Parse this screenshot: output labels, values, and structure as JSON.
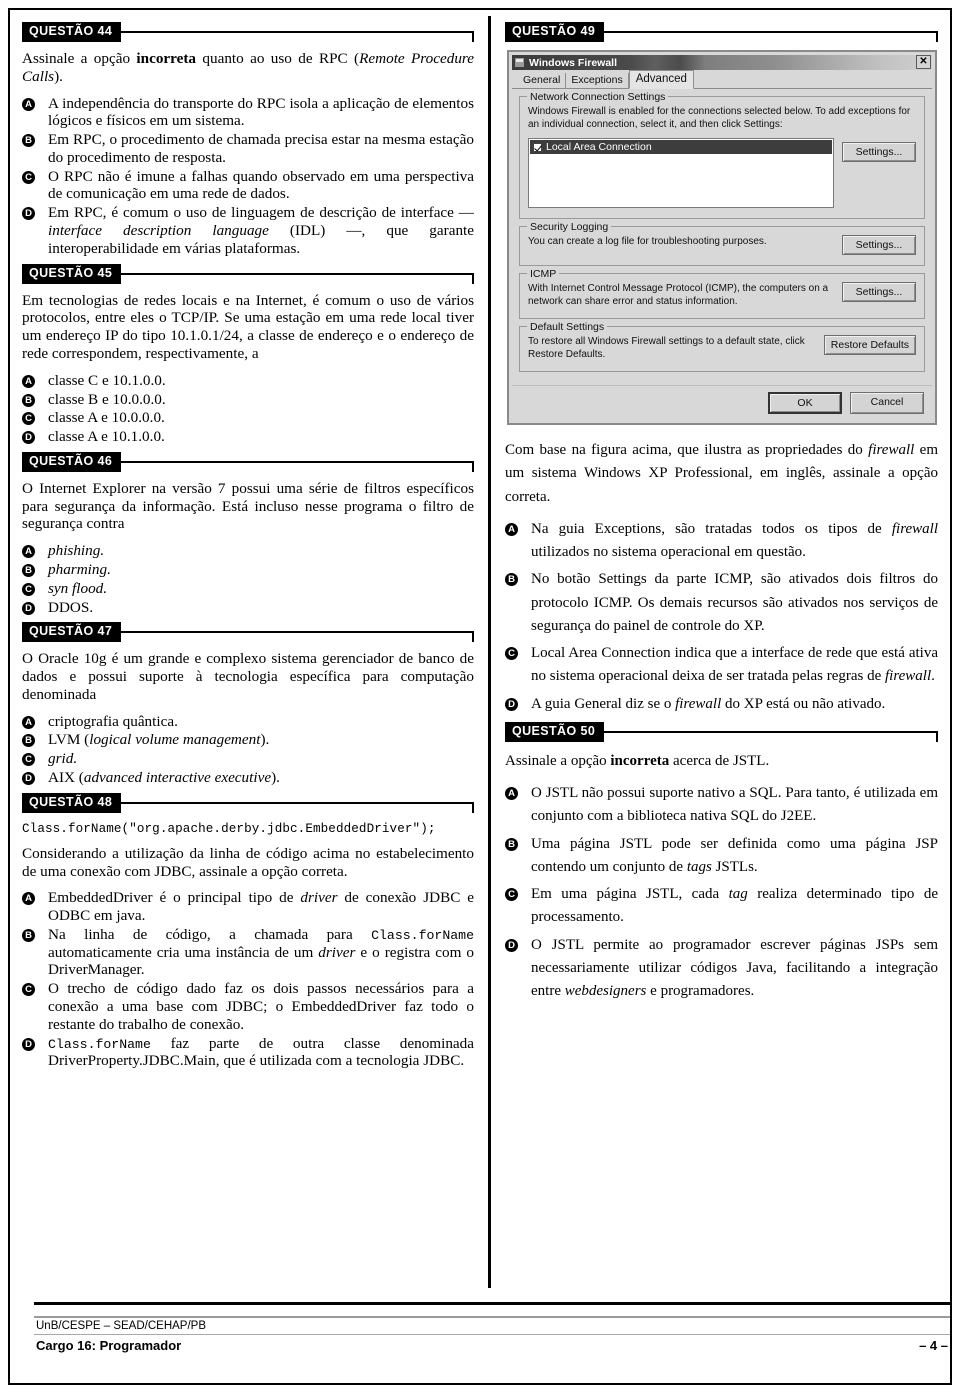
{
  "document": {
    "footer": {
      "institution": "UnB/CESPE – SEAD/CEHAP/PB",
      "role": "Cargo 16: Programador",
      "page_number": "– 4 –"
    }
  },
  "questions": {
    "q44": {
      "label": "QUESTÃO 44",
      "stem_a": "Assinale a opção ",
      "stem_bold": "incorreta",
      "stem_b": " quanto ao uso de RPC (",
      "stem_italic": "Remote Procedure Calls",
      "stem_c": ").",
      "options": [
        {
          "letter": "A",
          "text": "A independência do transporte do RPC isola a aplicação de elementos lógicos e físicos em um sistema."
        },
        {
          "letter": "B",
          "text": "Em RPC, o procedimento de chamada precisa estar na mesma estação do procedimento de resposta."
        },
        {
          "letter": "C",
          "text": "O RPC não é imune a falhas quando observado em uma perspectiva de comunicação em uma rede de dados."
        },
        {
          "letter": "D",
          "text": ""
        }
      ],
      "option_d_pre": "Em RPC, é comum o uso de linguagem de descrição de interface — ",
      "option_d_italic": "interface description language",
      "option_d_post": " (IDL) —, que garante interoperabilidade em várias plataformas."
    },
    "q45": {
      "label": "QUESTÃO 45",
      "stem": "Em tecnologias de redes locais e na Internet, é comum o uso de vários protocolos, entre eles o TCP/IP. Se uma estação em uma rede local tiver um endereço IP do tipo 10.1.0.1/24, a classe de endereço e o endereço de rede correspondem, respectivamente, a",
      "options": [
        {
          "letter": "A",
          "text": "classe C e 10.1.0.0."
        },
        {
          "letter": "B",
          "text": "classe B e 10.0.0.0."
        },
        {
          "letter": "C",
          "text": "classe A e 10.0.0.0."
        },
        {
          "letter": "D",
          "text": "classe A e 10.1.0.0."
        }
      ]
    },
    "q46": {
      "label": "QUESTÃO 46",
      "stem": "O Internet Explorer na versão 7 possui uma série de filtros específicos para segurança da informação. Está incluso nesse programa o filtro de segurança contra",
      "options": [
        {
          "letter": "A",
          "text": "phishing.",
          "italic": true
        },
        {
          "letter": "B",
          "text": "pharming.",
          "italic": true
        },
        {
          "letter": "C",
          "text": "syn flood.",
          "italic": true
        },
        {
          "letter": "D",
          "text": "DDOS.",
          "italic": false
        }
      ]
    },
    "q47": {
      "label": "QUESTÃO 47",
      "stem": "O Oracle 10g é um grande e complexo sistema gerenciador de banco de dados e possui suporte à tecnologia específica para computação denominada",
      "options": [
        {
          "letter": "A",
          "text": "criptografia quântica."
        },
        {
          "letter": "B",
          "text": "LVM (logical volume management)."
        },
        {
          "letter": "C",
          "text": "grid."
        },
        {
          "letter": "D",
          "text": "AIX (advanced interactive executive)."
        }
      ],
      "option_b_pre": "LVM (",
      "option_b_italic": "logical volume management",
      "option_b_post": ").",
      "option_c_italic": "grid.",
      "option_d_pre": "AIX (",
      "option_d_italic": "advanced interactive executive",
      "option_d_post": ")."
    },
    "q48": {
      "label": "QUESTÃO 48",
      "code": "Class.forName(\"org.apache.derby.jdbc.EmbeddedDriver\");",
      "stem": "Considerando a utilização da linha de código acima no estabelecimento de uma conexão com JDBC, assinale a opção correta.",
      "option_a_pre": "EmbeddedDriver é o principal tipo de ",
      "option_a_italic": "driver",
      "option_a_post": " de conexão JDBC e ODBC em java.",
      "option_b_pre": "Na linha de código, a chamada para ",
      "option_b_mono": "Class.forName",
      "option_b_mid": " automaticamente cria uma instância de um ",
      "option_b_italic": "driver",
      "option_b_post": " e o registra com o DriverManager.",
      "option_c": "O trecho de código dado faz os dois passos necessários para a conexão a uma base com JDBC; o EmbeddedDriver faz todo o restante do trabalho de conexão.",
      "option_d_mono": "Class.forName",
      "option_d_post": " faz parte de outra classe denominada DriverProperty.JDBC.Main, que é utilizada com a tecnologia JDBC.",
      "letters": [
        "A",
        "B",
        "C",
        "D"
      ]
    },
    "q49": {
      "label": "QUESTÃO 49",
      "stem_pre": "Com base na figura acima, que ilustra as propriedades do ",
      "stem_italic": "firewall",
      "stem_post": " em um sistema Windows XP Professional, em inglês, assinale a opção correta.",
      "option_a_pre": "Na guia Exceptions, são tratadas todos os tipos de ",
      "option_a_italic": "firewall",
      "option_a_post": " utilizados no sistema operacional em questão.",
      "option_b": "No botão Settings da parte ICMP, são ativados dois filtros do protocolo ICMP. Os demais recursos são ativados nos serviços de segurança do painel de controle do XP.",
      "option_c_pre": "Local Area Connection indica que a interface de rede que está ativa no sistema operacional deixa de ser tratada pelas regras de ",
      "option_c_italic": "firewall",
      "option_c_post": ".",
      "option_d_pre": "A guia General diz se o ",
      "option_d_italic": "firewall",
      "option_d_post": " do XP está ou não ativado.",
      "letters": [
        "A",
        "B",
        "C",
        "D"
      ]
    },
    "q50": {
      "label": "QUESTÃO 50",
      "stem_pre": "Assinale a opção ",
      "stem_bold": "incorreta",
      "stem_post": " acerca de JSTL.",
      "option_a": "O JSTL não possui suporte nativo a SQL. Para tanto, é utilizada em conjunto com a biblioteca nativa SQL do J2EE.",
      "option_b_pre": "Uma página JSTL pode ser definida como uma página JSP contendo um conjunto de ",
      "option_b_italic": "tags",
      "option_b_post": " JSTLs.",
      "option_c_pre": "Em uma página JSTL, cada ",
      "option_c_italic": "tag",
      "option_c_post": " realiza determinado tipo de processamento.",
      "option_d_pre": "O JSTL permite ao programador escrever páginas JSPs sem necessariamente utilizar códigos Java, facilitando a integração entre ",
      "option_d_italic": "webdesigners",
      "option_d_post": " e programadores.",
      "letters": [
        "A",
        "B",
        "C",
        "D"
      ]
    }
  },
  "firewall_dialog": {
    "title": "Windows Firewall",
    "close_label": "✕",
    "tabs": [
      {
        "label": "General",
        "active": false
      },
      {
        "label": "Exceptions",
        "active": false
      },
      {
        "label": "Advanced",
        "active": true
      }
    ],
    "groups": [
      {
        "legend": "Network Connection Settings",
        "description": "Windows Firewall is enabled for the connections selected below. To add exceptions for an individual connection, select it, and then click Settings:",
        "list_item": "Local Area Connection",
        "button": "Settings..."
      },
      {
        "legend": "Security Logging",
        "description": "You can create a log file for troubleshooting purposes.",
        "button": "Settings..."
      },
      {
        "legend": "ICMP",
        "description": "With Internet Control Message Protocol (ICMP), the computers on a network can share error and status information.",
        "button": "Settings..."
      },
      {
        "legend": "Default Settings",
        "description": "To restore all Windows Firewall settings to a default state, click Restore Defaults.",
        "button": "Restore Defaults"
      }
    ],
    "ok_label": "OK",
    "cancel_label": "Cancel"
  }
}
